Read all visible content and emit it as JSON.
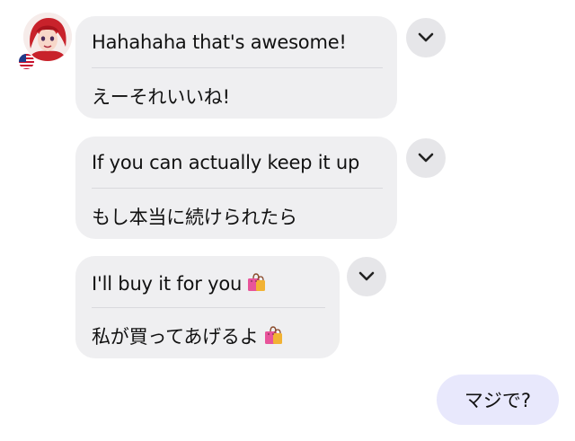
{
  "sender": {
    "avatar_alt": "",
    "flag": "us-flag-icon"
  },
  "messages": [
    {
      "original": "Hahahaha that's awesome!",
      "translation": "えーそれいいね!"
    },
    {
      "original": "If you can actually keep it up",
      "translation": "もし本当に続けられたら"
    },
    {
      "original": "I'll buy it for you",
      "translation": "私が買ってあげるよ"
    }
  ],
  "reply": {
    "text": "マジで?"
  },
  "colors": {
    "incoming_bubble": "#efeff1",
    "outgoing_bubble": "#e8e8fc",
    "chevron_button": "#e6e6e9"
  },
  "icons": {
    "expand": "chevron-down-icon",
    "emoji": "shopping-bags-icon"
  }
}
